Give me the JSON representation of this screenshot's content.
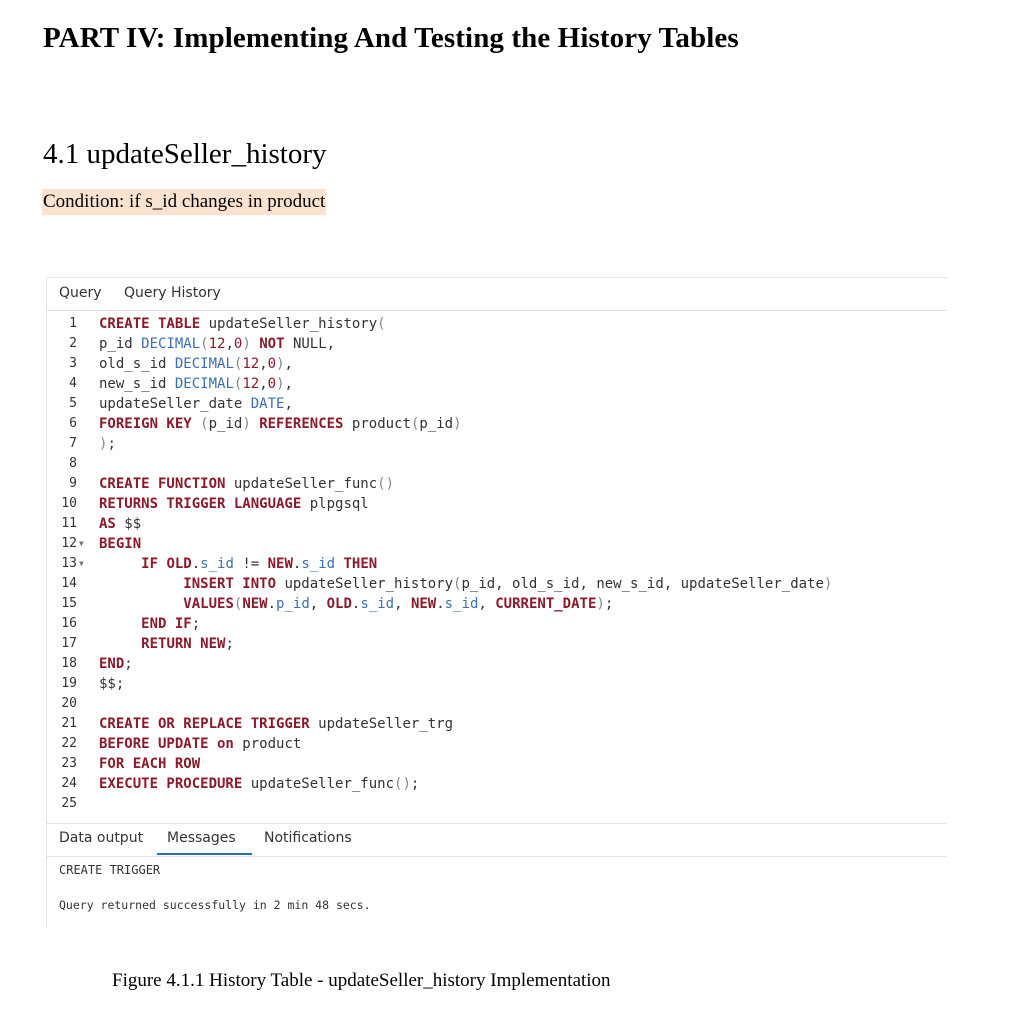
{
  "document": {
    "part_title": "PART IV: Implementing And Testing the History Tables",
    "section_title": "4.1 updateSeller_history",
    "condition": "Condition: if s_id changes in product",
    "caption": "Figure 4.1.1 History Table - updateSeller_history Implementation"
  },
  "query_tabs": [
    "Query",
    "Query History"
  ],
  "editor": {
    "line_numbers": [
      "1",
      "2",
      "3",
      "4",
      "5",
      "6",
      "7",
      "8",
      "9",
      "10",
      "11",
      "12",
      "13",
      "14",
      "15",
      "16",
      "17",
      "18",
      "19",
      "20",
      "21",
      "22",
      "23",
      "24",
      "25"
    ],
    "fold_markers": [
      "12",
      "13"
    ]
  },
  "result_tabs": [
    "Data output",
    "Messages",
    "Notifications"
  ],
  "active_result_tab": "Messages",
  "messages": {
    "line1": "CREATE TRIGGER",
    "line2": "Query returned successfully in 2 min 48 secs."
  },
  "colors": {
    "keyword": "#8b1a2b",
    "type": "#3b6fb3",
    "condition_highlight": "#fbe3d0",
    "active_tab_underline": "#2a6ebb"
  }
}
